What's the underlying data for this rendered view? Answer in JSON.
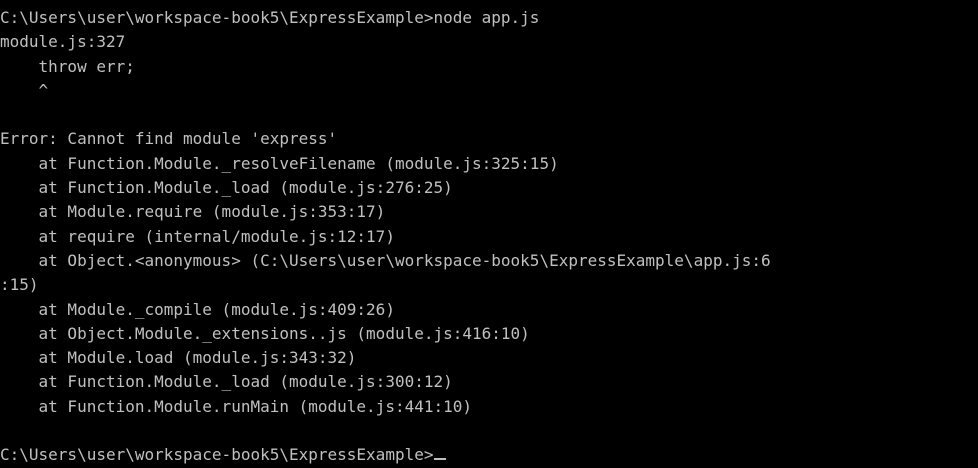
{
  "console": {
    "lines": [
      "C:\\Users\\user\\workspace-book5\\ExpressExample>node app.js",
      "module.js:327",
      "    throw err;",
      "    ^",
      "",
      "Error: Cannot find module 'express'",
      "    at Function.Module._resolveFilename (module.js:325:15)",
      "    at Function.Module._load (module.js:276:25)",
      "    at Module.require (module.js:353:17)",
      "    at require (internal/module.js:12:17)",
      "    at Object.<anonymous> (C:\\Users\\user\\workspace-book5\\ExpressExample\\app.js:6",
      ":15)",
      "    at Module._compile (module.js:409:26)",
      "    at Object.Module._extensions..js (module.js:416:10)",
      "    at Module.load (module.js:343:32)",
      "    at Function.Module._load (module.js:300:12)",
      "    at Function.Module.runMain (module.js:441:10)",
      ""
    ],
    "prompt": "C:\\Users\\user\\workspace-book5\\ExpressExample>"
  },
  "colors": {
    "background": "#000000",
    "text": "#c0c0c0"
  }
}
